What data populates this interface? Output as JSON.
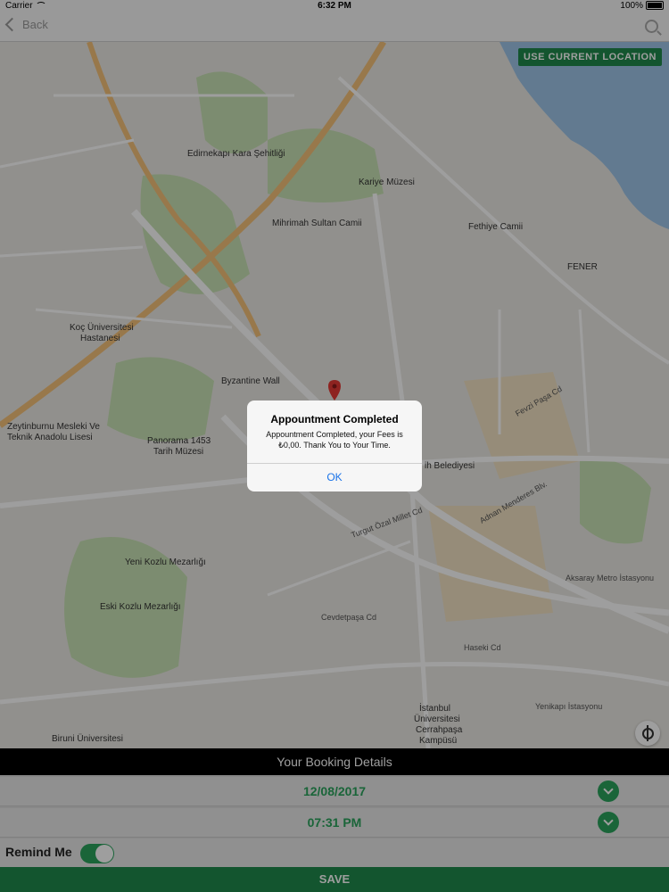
{
  "status_bar": {
    "carrier": "Carrier",
    "time": "6:32 PM",
    "battery": "100%"
  },
  "nav": {
    "back_label": "Back"
  },
  "map": {
    "use_location_label": "USE CURRENT LOCATION",
    "labels": {
      "edirnekapi": "Edirnekapı Kara Şehitliği",
      "kariye": "Kariye Müzesi",
      "mihrimah": "Mihrimah Sultan Camii",
      "fethiye": "Fethiye Camii",
      "fener": "FENER",
      "koc": "Koç Üniversitesi",
      "koc2": "Hastanesi",
      "byzantine": "Byzantine Wall",
      "zeytinburnu": "Zeytinburnu Mesleki Ve",
      "zeytinburnu2": "Teknik Anadolu Lisesi",
      "panorama": "Panorama 1453",
      "panorama2": "Tarih Müzesi",
      "belediye": "ih Belediyesi",
      "yeni_kozlu": "Yeni Kozlu Mezarlığı",
      "eski_kozlu": "Eski Kozlu Mezarlığı",
      "biruni": "Biruni Üniversitesi",
      "istanbul_uni": "İstanbul",
      "istanbul_uni2": "Üniversitesi",
      "istanbul_uni3": "Cerrahpaşa",
      "istanbul_uni4": "Kampüsü",
      "aksaray": "Aksaray Metro İstasyonu",
      "yenikapi": "Yenikapı İstasyonu",
      "cevdetpasa": "Cevdetpaşa Cd",
      "turgut": "Turgut Özal Millet Cd",
      "adnan": "Adnan Menderes Blv.",
      "haseki": "Haseki Cd",
      "fevzi": "Fevzi Paşa Cd"
    }
  },
  "alert": {
    "title": "Appountment Completed",
    "message": "Appountment Completed, your Fees is ₺0,00. Thank You to Your Time.",
    "ok_label": "OK"
  },
  "booking": {
    "header": "Your Booking Details",
    "date": "12/08/2017",
    "time": "07:31 PM",
    "remind_label": "Remind Me",
    "remind_on": true,
    "save_label": "SAVE"
  },
  "colors": {
    "accent": "#2aa35d",
    "save_bg": "#1f8a4c",
    "link": "#1a73e8"
  }
}
